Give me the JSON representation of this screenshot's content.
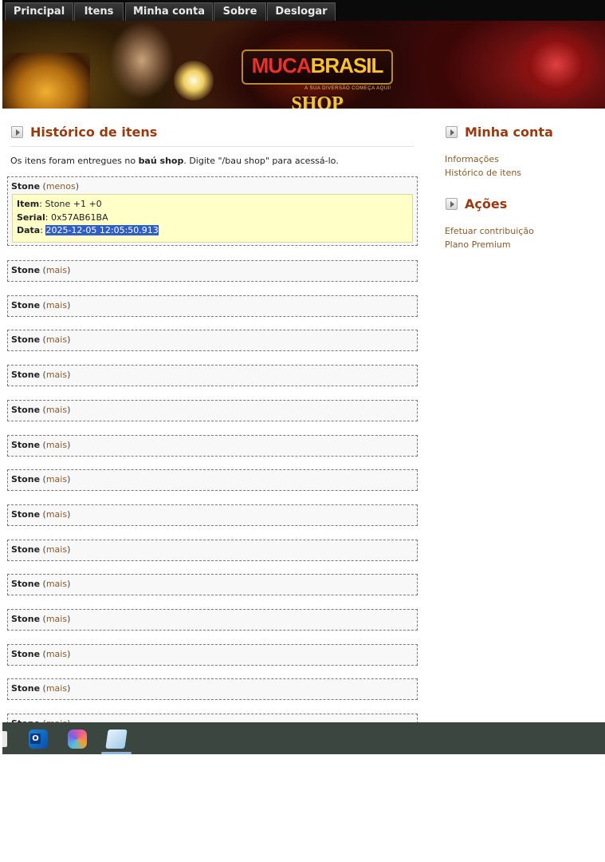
{
  "nav": {
    "tabs": [
      {
        "label": "Principal"
      },
      {
        "label": "Itens"
      },
      {
        "label": "Minha conta"
      },
      {
        "label": "Sobre"
      },
      {
        "label": "Deslogar"
      }
    ]
  },
  "banner": {
    "logo_part1": "MUCA",
    "logo_part2": "BRASIL",
    "tagline": "A SUA DIVERSÃO COMEÇA AQUI!",
    "shop": "SHOP"
  },
  "main": {
    "title": "Histórico de itens",
    "intro_before": "Os itens foram entregues no ",
    "intro_bold": "baú shop",
    "intro_after": ". Digite \"/bau shop\" para acessá-lo.",
    "expanded_item": {
      "name": "Stone",
      "toggle": "menos",
      "item_label": "Item",
      "item_value": "Stone +1 +0",
      "serial_label": "Serial",
      "serial_value": "0x57AB61BA",
      "date_label": "Data",
      "date_value": "2025-12-05 12:05:50.913"
    },
    "collapsed_items": [
      {
        "name": "Stone",
        "toggle": "mais"
      },
      {
        "name": "Stone",
        "toggle": "mais"
      },
      {
        "name": "Stone",
        "toggle": "mais"
      },
      {
        "name": "Stone",
        "toggle": "mais"
      },
      {
        "name": "Stone",
        "toggle": "mais"
      },
      {
        "name": "Stone",
        "toggle": "mais"
      },
      {
        "name": "Stone",
        "toggle": "mais"
      },
      {
        "name": "Stone",
        "toggle": "mais"
      },
      {
        "name": "Stone",
        "toggle": "mais"
      },
      {
        "name": "Stone",
        "toggle": "mais"
      },
      {
        "name": "Stone",
        "toggle": "mais"
      },
      {
        "name": "Stone",
        "toggle": "mais"
      },
      {
        "name": "Stone",
        "toggle": "mais"
      },
      {
        "name": "Stone",
        "toggle": "mais"
      }
    ]
  },
  "sidebar": {
    "account_title": "Minha conta",
    "account_links": [
      {
        "label": "Informações"
      },
      {
        "label": "Histórico de itens"
      }
    ],
    "actions_title": "Ações",
    "action_links": [
      {
        "label": "Efetuar contribuição"
      },
      {
        "label": "Plano Premium"
      }
    ]
  },
  "taskbar": {
    "icons": [
      "file-icon",
      "outlook-icon",
      "copilot-icon",
      "notepad-icon"
    ],
    "outlook_letter": "O"
  },
  "colors": {
    "heading": "#9a3a10",
    "link": "#8a5a2a",
    "detail_bg": "#ffffc8",
    "selection": "#2f5fc4",
    "taskbar": "#3c4640"
  }
}
